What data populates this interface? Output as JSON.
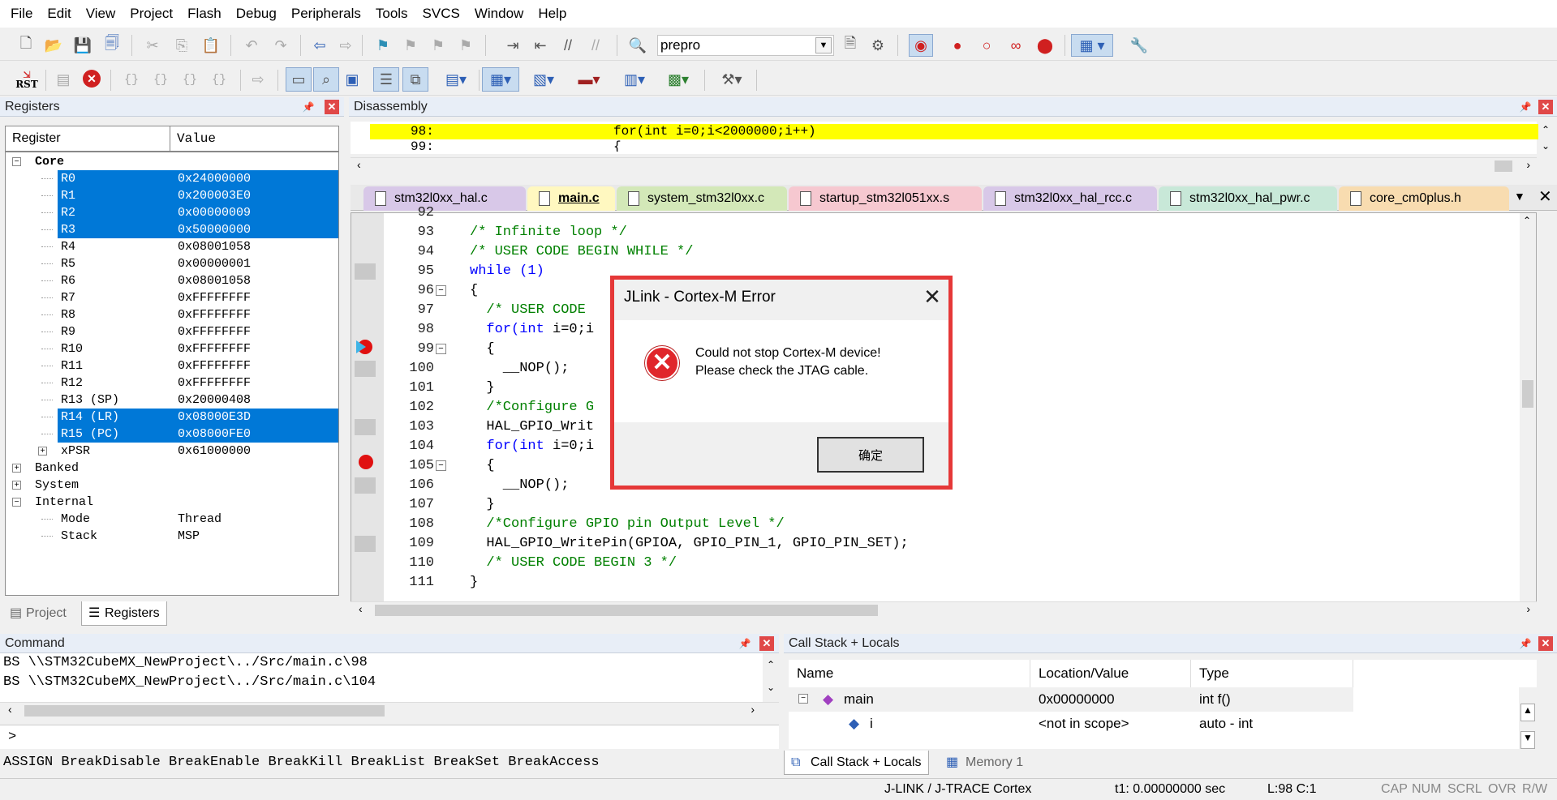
{
  "menu": [
    "File",
    "Edit",
    "View",
    "Project",
    "Flash",
    "Debug",
    "Peripherals",
    "Tools",
    "SVCS",
    "Window",
    "Help"
  ],
  "toolbar": {
    "target_name": "prepro",
    "rst_label": "RST"
  },
  "registers": {
    "title": "Registers",
    "col_register": "Register",
    "col_value": "Value",
    "core_label": "Core",
    "rows": [
      {
        "name": "R0",
        "value": "0x24000000"
      },
      {
        "name": "R1",
        "value": "0x200003E0"
      },
      {
        "name": "R2",
        "value": "0x00000009"
      },
      {
        "name": "R3",
        "value": "0x50000000"
      },
      {
        "name": "R4",
        "value": "0x08001058"
      },
      {
        "name": "R5",
        "value": "0x00000001"
      },
      {
        "name": "R6",
        "value": "0x08001058"
      },
      {
        "name": "R7",
        "value": "0xFFFFFFFF"
      },
      {
        "name": "R8",
        "value": "0xFFFFFFFF"
      },
      {
        "name": "R9",
        "value": "0xFFFFFFFF"
      },
      {
        "name": "R10",
        "value": "0xFFFFFFFF"
      },
      {
        "name": "R11",
        "value": "0xFFFFFFFF"
      },
      {
        "name": "R12",
        "value": "0xFFFFFFFF"
      },
      {
        "name": "R13 (SP)",
        "value": "0x20000408"
      },
      {
        "name": "R14 (LR)",
        "value": "0x08000E3D"
      },
      {
        "name": "R15 (PC)",
        "value": "0x08000FE0"
      },
      {
        "name": "xPSR",
        "value": "0x61000000"
      }
    ],
    "banked": "Banked",
    "system": "System",
    "internal": "Internal",
    "mode_label": "Mode",
    "mode_value": "Thread",
    "stack_label": "Stack",
    "stack_value": "MSP",
    "tab_project": "Project",
    "tab_registers": "Registers"
  },
  "disassembly": {
    "title": "Disassembly",
    "line1_num": "98:",
    "line1_code": "for(int i=0;i<2000000;i++)",
    "line2_num": "99:",
    "line2_code": "{"
  },
  "editor_tabs": [
    {
      "label": "stm32l0xx_hal.c",
      "color": "#d8c8e8"
    },
    {
      "label": "main.c",
      "color": "#f6f0a8"
    },
    {
      "label": "system_stm32l0xx.c",
      "color": "#d3e8b8"
    },
    {
      "label": "startup_stm32l051xx.s",
      "color": "#f6c8d0"
    },
    {
      "label": "stm32l0xx_hal_rcc.c",
      "color": "#d8c8e8"
    },
    {
      "label": "stm32l0xx_hal_pwr.c",
      "color": "#c8e8d8"
    },
    {
      "label": "core_cm0plus.h",
      "color": "#f8dcb0"
    }
  ],
  "code_lines": [
    {
      "num": "92",
      "text": ""
    },
    {
      "num": "93",
      "text": "/* Infinite loop */"
    },
    {
      "num": "94",
      "text": "/* USER CODE BEGIN WHILE */"
    },
    {
      "num": "95",
      "text": "while (1)"
    },
    {
      "num": "96",
      "text": "{"
    },
    {
      "num": "97",
      "text": "  /* USER CODE"
    },
    {
      "num": "98",
      "text": "  for(int i=0;i"
    },
    {
      "num": "99",
      "text": "  {"
    },
    {
      "num": "100",
      "text": "    __NOP();"
    },
    {
      "num": "101",
      "text": "  }"
    },
    {
      "num": "102",
      "text": "  /*Configure G"
    },
    {
      "num": "103",
      "text": "  HAL_GPIO_Writ                    SET);"
    },
    {
      "num": "104",
      "text": "  for(int i=0;i"
    },
    {
      "num": "105",
      "text": "  {"
    },
    {
      "num": "106",
      "text": "    __NOP();"
    },
    {
      "num": "107",
      "text": "  }"
    },
    {
      "num": "108",
      "text": "  /*Configure GPIO pin Output Level */"
    },
    {
      "num": "109",
      "text": "  HAL_GPIO_WritePin(GPIOA, GPIO_PIN_1, GPIO_PIN_SET);"
    },
    {
      "num": "110",
      "text": "  /* USER CODE BEGIN 3 */"
    },
    {
      "num": "111",
      "text": "}"
    }
  ],
  "dialog": {
    "title": "JLink - Cortex-M Error",
    "close": "✕",
    "message1": "Could not stop Cortex-M device!",
    "message2": "Please check the JTAG cable.",
    "ok_label": "确定"
  },
  "command": {
    "title": "Command",
    "lines": [
      "BS \\\\STM32CubeMX_NewProject\\../Src/main.c\\98",
      "BS \\\\STM32CubeMX_NewProject\\../Src/main.c\\104"
    ],
    "prompt": ">",
    "help": "ASSIGN BreakDisable BreakEnable BreakKill BreakList BreakSet BreakAccess"
  },
  "callstack": {
    "title": "Call Stack + Locals",
    "col_name": "Name",
    "col_location": "Location/Value",
    "col_type": "Type",
    "rows": [
      {
        "name": "main",
        "value": "0x00000000",
        "type": "int f()"
      },
      {
        "name": "i",
        "value": "<not in scope>",
        "type": "auto - int"
      }
    ],
    "tab_callstack": "Call Stack + Locals",
    "tab_memory": "Memory 1"
  },
  "status": {
    "debugger": "J-LINK / J-TRACE Cortex",
    "time": "t1: 0.00000000 sec",
    "position": "L:98 C:1",
    "cap": "CAP",
    "num": "NUM",
    "scrl": "SCRL",
    "ovr": "OVR",
    "rw": "R/W"
  }
}
